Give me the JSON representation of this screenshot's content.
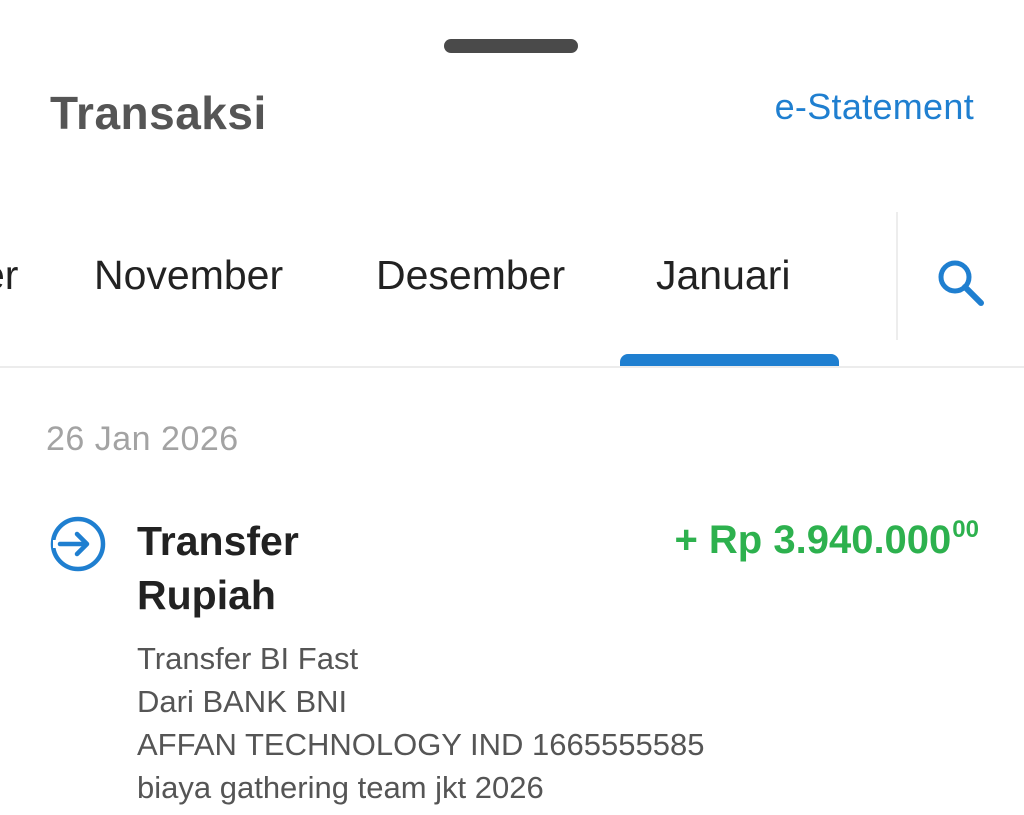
{
  "header": {
    "title": "Transaksi",
    "link_label": "e-Statement"
  },
  "tabs": {
    "items": [
      {
        "label": "er",
        "selected": false
      },
      {
        "label": "November",
        "selected": false
      },
      {
        "label": "Desember",
        "selected": false
      },
      {
        "label": "Januari",
        "selected": true
      }
    ],
    "search_icon": "search-icon"
  },
  "transactions": {
    "date": "26 Jan 2026",
    "items": [
      {
        "icon": "transfer-in-icon",
        "title": "Transfer Rupiah",
        "amount": "+ Rp 3.940.000",
        "amount_cents": "00",
        "details": [
          "Transfer BI Fast",
          "Dari BANK BNI",
          "AFFAN TECHNOLOGY IND 1665555585",
          "biaya gathering team jkt 2026"
        ]
      }
    ]
  },
  "colors": {
    "accent": "#1f7fd0",
    "credit": "#2db14e",
    "title": "#555555",
    "muted": "#a3a3a3"
  }
}
